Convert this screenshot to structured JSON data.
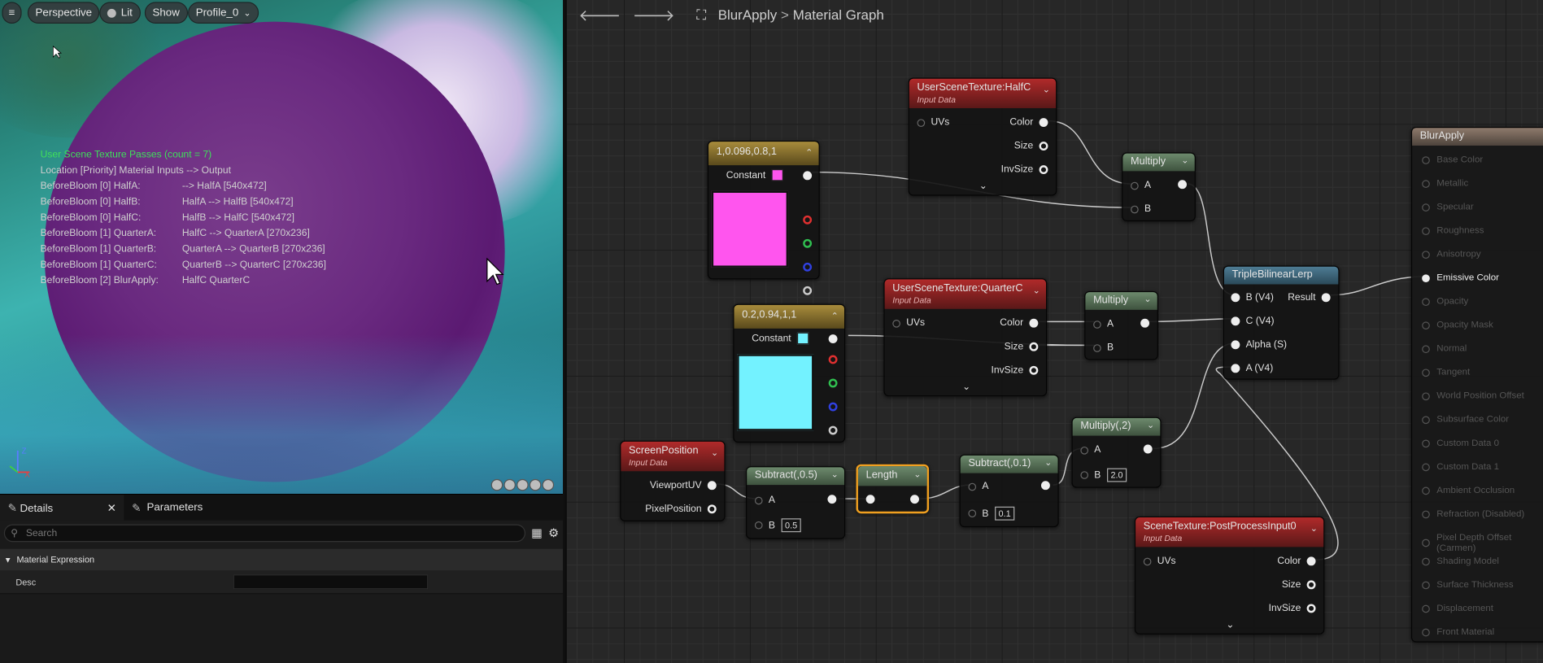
{
  "viewport": {
    "menu_icon": "menu-icon",
    "perspective": "Perspective",
    "lit": "Lit",
    "show": "Show",
    "profile": "Profile_0",
    "stats_title": "User Scene Texture Passes (count = 7)",
    "stats_header": "Location [Priority]  Material    Inputs  --> Output",
    "stats_rows": [
      {
        "loc": "BeforeBloom [0]  HalfA:",
        "io": "--> HalfA [540x472]"
      },
      {
        "loc": "BeforeBloom [0]  HalfB:",
        "io": "HalfA  --> HalfB [540x472]"
      },
      {
        "loc": "BeforeBloom [0]  HalfC:",
        "io": "HalfB  --> HalfC [540x472]"
      },
      {
        "loc": "BeforeBloom [1]  QuarterA:",
        "io": "HalfC  --> QuarterA [270x236]"
      },
      {
        "loc": "BeforeBloom [1]  QuarterB:",
        "io": "QuarterA  --> QuarterB [270x236]"
      },
      {
        "loc": "BeforeBloom [1]  QuarterC:",
        "io": "QuarterB  --> QuarterC [270x236]"
      },
      {
        "loc": "BeforeBloom [2]  BlurApply:",
        "io": "HalfC  QuarterC"
      }
    ]
  },
  "details": {
    "tab_details": "Details",
    "tab_parameters": "Parameters",
    "search_placeholder": "Search",
    "section": "Material Expression",
    "desc_label": "Desc"
  },
  "graph": {
    "title": "BlurApply",
    "crumb_sep": ">",
    "crumb": "Material Graph",
    "nodes": {
      "ust_halfc": {
        "title": "UserSceneTexture:HalfC",
        "sub": "Input Data",
        "uvs": "UVs",
        "color": "Color",
        "size": "Size",
        "invsize": "InvSize"
      },
      "const1": {
        "title": "1,0.096,0.8,1",
        "constant": "Constant",
        "color": "#ff55ee"
      },
      "multiply1": {
        "title": "Multiply",
        "a": "A",
        "b": "B"
      },
      "ust_quarterc": {
        "title": "UserSceneTexture:QuarterC",
        "sub": "Input Data",
        "uvs": "UVs",
        "color": "Color",
        "size": "Size",
        "invsize": "InvSize"
      },
      "const2": {
        "title": "0.2,0.94,1,1",
        "constant": "Constant",
        "color": "#73f2ff"
      },
      "multiply2": {
        "title": "Multiply",
        "a": "A",
        "b": "B"
      },
      "lerp": {
        "title": "TripleBilinearLerp",
        "b": "B (V4)",
        "c": "C (V4)",
        "alpha": "Alpha (S)",
        "a": "A (V4)",
        "result": "Result"
      },
      "screenpos": {
        "title": "ScreenPosition",
        "sub": "Input Data",
        "viewportuv": "ViewportUV",
        "pixelpos": "PixelPosition"
      },
      "subtract1": {
        "title": "Subtract(,0.5)",
        "a": "A",
        "b": "B",
        "bval": "0.5"
      },
      "length": {
        "title": "Length"
      },
      "subtract2": {
        "title": "Subtract(,0.1)",
        "a": "A",
        "b": "B",
        "bval": "0.1"
      },
      "multiply3": {
        "title": "Multiply(,2)",
        "a": "A",
        "b": "B",
        "bval": "2.0"
      },
      "scenetex": {
        "title": "SceneTexture:PostProcessInput0",
        "sub": "Input Data",
        "uvs": "UVs",
        "color": "Color",
        "size": "Size",
        "invsize": "InvSize"
      }
    },
    "result_node": {
      "title": "BlurApply",
      "pins": [
        "Base Color",
        "Metallic",
        "Specular",
        "Roughness",
        "Anisotropy",
        "Emissive Color",
        "Opacity",
        "Opacity Mask",
        "Normal",
        "Tangent",
        "World Position Offset",
        "Subsurface Color",
        "Custom Data 0",
        "Custom Data 1",
        "Ambient Occlusion",
        "Refraction (Disabled)",
        "Pixel Depth Offset (Carmen)",
        "Shading Model",
        "Surface Thickness",
        "Displacement",
        "Front Material"
      ],
      "active_pin": "Emissive Color"
    }
  }
}
